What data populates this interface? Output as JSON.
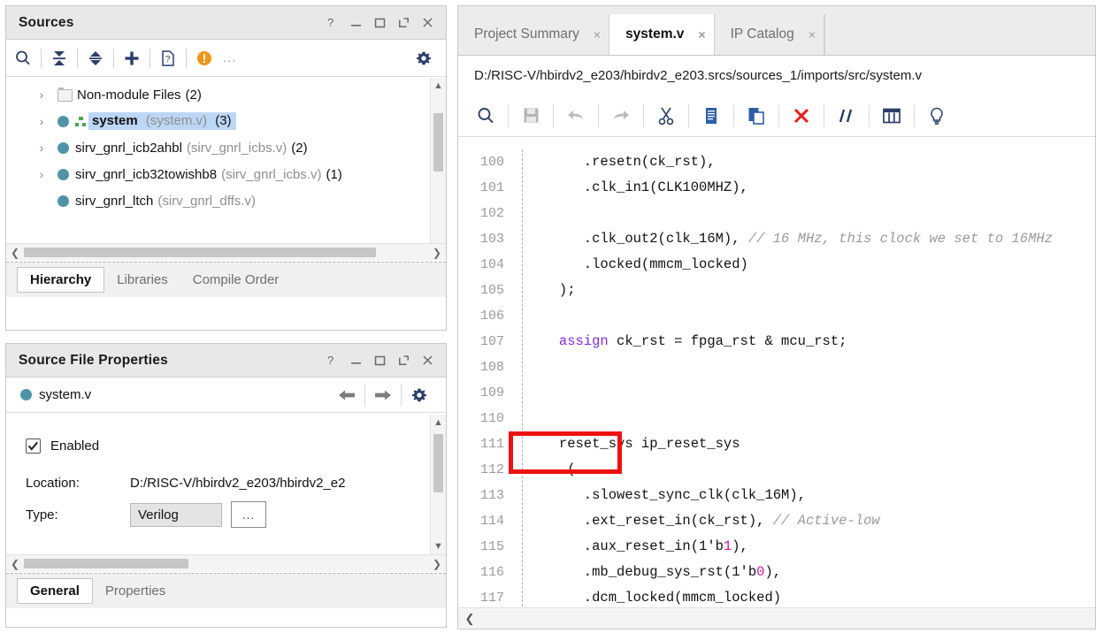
{
  "sources_panel": {
    "title": "Sources",
    "title_buttons": [
      "?",
      "_",
      "□",
      "⇱",
      "✕"
    ],
    "toolbar": {
      "search": "search-icon",
      "collapse_all": "collapse-all-icon",
      "expand_all": "expand-all-icon",
      "add": "add-sources-icon",
      "help": "file-help-icon",
      "warning": "warning-icon",
      "warning_text": "...",
      "settings": "gear-icon"
    },
    "tree": [
      {
        "caret": "›",
        "icon": "folder",
        "name": "Non-module Files",
        "sub": "",
        "count": "(2)",
        "selected": false,
        "bold": false
      },
      {
        "caret": "›",
        "icon": "module-hier",
        "name": "system",
        "sub": "(system.v)",
        "count": "(3)",
        "selected": true,
        "bold": true
      },
      {
        "caret": "›",
        "icon": "module",
        "name": "sirv_gnrl_icb2ahbl",
        "sub": "(sirv_gnrl_icbs.v)",
        "count": "(2)",
        "selected": false,
        "bold": false
      },
      {
        "caret": "›",
        "icon": "module",
        "name": "sirv_gnrl_icb32towishb8",
        "sub": "(sirv_gnrl_icbs.v)",
        "count": "(1)",
        "selected": false,
        "bold": false
      },
      {
        "caret": "",
        "icon": "module",
        "name": "sirv_gnrl_ltch",
        "sub": "(sirv_gnrl_dffs.v)",
        "count": "",
        "selected": false,
        "bold": false
      }
    ],
    "tabs": [
      {
        "label": "Hierarchy",
        "active": true
      },
      {
        "label": "Libraries",
        "active": false
      },
      {
        "label": "Compile Order",
        "active": false
      }
    ]
  },
  "properties_panel": {
    "title": "Source File Properties",
    "title_buttons": [
      "?",
      "_",
      "□",
      "⇱",
      "✕"
    ],
    "file_name": "system.v",
    "nav": {
      "back": "back-arrow-icon",
      "forward": "forward-arrow-icon",
      "settings": "gear-icon"
    },
    "rows": {
      "enabled_label": "Enabled",
      "enabled_checked": true,
      "location_label": "Location:",
      "location_value": "D:/RISC-V/hbirdv2_e203/hbirdv2_e2",
      "type_label": "Type:",
      "type_value": "Verilog",
      "type_browse": "..."
    },
    "tabs": [
      {
        "label": "General",
        "active": true
      },
      {
        "label": "Properties",
        "active": false
      }
    ]
  },
  "editor": {
    "tabs": [
      {
        "label": "Project Summary",
        "active": false,
        "close": "×"
      },
      {
        "label": "system.v",
        "active": true,
        "close": "×"
      },
      {
        "label": "IP Catalog",
        "active": false,
        "close": "×"
      }
    ],
    "path": "D:/RISC-V/hbirdv2_e203/hbirdv2_e203.srcs/sources_1/imports/src/system.v",
    "toolbar": [
      {
        "name": "find-icon",
        "enabled": true
      },
      {
        "name": "save-icon",
        "enabled": false
      },
      {
        "name": "undo-icon",
        "enabled": false
      },
      {
        "name": "redo-icon",
        "enabled": false
      },
      {
        "name": "cut-icon",
        "enabled": true
      },
      {
        "name": "copy-icon",
        "enabled": true
      },
      {
        "name": "paste-icon",
        "enabled": true
      },
      {
        "name": "delete-icon",
        "enabled": true
      },
      {
        "name": "comment-icon",
        "enabled": true
      },
      {
        "name": "columns-icon",
        "enabled": true
      },
      {
        "name": "lightbulb-icon",
        "enabled": true
      }
    ],
    "first_line_number": 100,
    "lines": [
      {
        "n": "100",
        "segments": [
          {
            "t": "      .resetn(ck_rst),",
            "c": ""
          }
        ]
      },
      {
        "n": "101",
        "segments": [
          {
            "t": "      .clk_in1(CLK100MHZ),",
            "c": ""
          }
        ]
      },
      {
        "n": "102",
        "segments": [
          {
            "t": "",
            "c": ""
          }
        ]
      },
      {
        "n": "103",
        "segments": [
          {
            "t": "      .clk_out2(clk_16M), ",
            "c": ""
          },
          {
            "t": "// 16 MHz, this clock we set to 16MHz",
            "c": "cm"
          }
        ]
      },
      {
        "n": "104",
        "segments": [
          {
            "t": "      .locked(mmcm_locked)",
            "c": ""
          }
        ]
      },
      {
        "n": "105",
        "segments": [
          {
            "t": "   );",
            "c": ""
          }
        ]
      },
      {
        "n": "106",
        "segments": [
          {
            "t": "",
            "c": ""
          }
        ]
      },
      {
        "n": "107",
        "segments": [
          {
            "t": "   ",
            "c": ""
          },
          {
            "t": "assign",
            "c": "kw"
          },
          {
            "t": " ck_rst = fpga_rst & mcu_rst;",
            "c": ""
          }
        ]
      },
      {
        "n": "108",
        "segments": [
          {
            "t": "",
            "c": ""
          }
        ]
      },
      {
        "n": "109",
        "segments": [
          {
            "t": "",
            "c": ""
          }
        ]
      },
      {
        "n": "110",
        "segments": [
          {
            "t": "",
            "c": ""
          }
        ]
      },
      {
        "n": "111",
        "segments": [
          {
            "t": "   reset_sys ip_reset_sys",
            "c": ""
          }
        ]
      },
      {
        "n": "112",
        "segments": [
          {
            "t": "    (",
            "c": ""
          }
        ]
      },
      {
        "n": "113",
        "segments": [
          {
            "t": "      .slowest_sync_clk(clk_16M),",
            "c": ""
          }
        ]
      },
      {
        "n": "114",
        "segments": [
          {
            "t": "      .ext_reset_in(ck_rst), ",
            "c": ""
          },
          {
            "t": "// Active-low",
            "c": "cm"
          }
        ]
      },
      {
        "n": "115",
        "segments": [
          {
            "t": "      .aux_reset_in(1'b",
            "c": ""
          },
          {
            "t": "1",
            "c": "num"
          },
          {
            "t": "),",
            "c": ""
          }
        ]
      },
      {
        "n": "116",
        "segments": [
          {
            "t": "      .mb_debug_sys_rst(1'b",
            "c": ""
          },
          {
            "t": "0",
            "c": "num"
          },
          {
            "t": "),",
            "c": ""
          }
        ]
      },
      {
        "n": "117",
        "segments": [
          {
            "t": "      .dcm_locked(mmcm_locked)",
            "c": ""
          }
        ]
      }
    ],
    "annotation": {
      "shape": "rectangle",
      "color": "#ee1111",
      "targets_line": "111"
    }
  },
  "colors": {
    "accent_blue": "#2c3e6b",
    "module_teal": "#4e94a6",
    "selection_blue": "#bcd6f5",
    "warning_orange": "#f0951a",
    "delete_red": "#e8201a",
    "annotation_red": "#ee1111",
    "keyword_purple": "#8a2be2",
    "comment_gray": "#9a9a9a",
    "number_magenta": "#d219a0"
  }
}
